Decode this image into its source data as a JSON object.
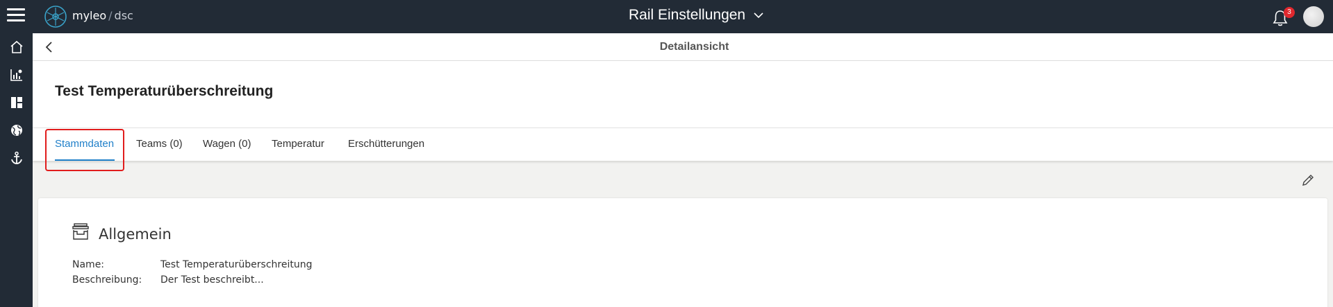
{
  "header": {
    "brand": "myleo",
    "brand_separator": "/",
    "brand_sub": "dsc",
    "app_title": "Rail Einstellungen",
    "notification_count": "3"
  },
  "sidebar": {
    "items": [
      {
        "icon": "home-icon"
      },
      {
        "icon": "analytics-icon"
      },
      {
        "icon": "dashboard-icon"
      },
      {
        "icon": "globe-icon"
      },
      {
        "icon": "anchor-icon"
      }
    ]
  },
  "detail": {
    "bar_title": "Detailansicht",
    "page_title": "Test Temperaturüberschreitung"
  },
  "tabs": [
    {
      "label": "Stammdaten",
      "active": true
    },
    {
      "label": "Teams (0)",
      "active": false
    },
    {
      "label": "Wagen (0)",
      "active": false
    },
    {
      "label": "Temperatur",
      "active": false
    },
    {
      "label": "Erschütterungen",
      "active": false
    }
  ],
  "general": {
    "heading": "Allgemein",
    "fields": [
      {
        "label": "Name:",
        "value": "Test Temperaturüberschreitung"
      },
      {
        "label": "Beschreibung:",
        "value": "Der Test beschreibt..."
      }
    ]
  },
  "colors": {
    "topbar": "#222b36",
    "accent": "#1f7fc9",
    "highlight": "#e11c1c",
    "badge": "#e0282e"
  }
}
